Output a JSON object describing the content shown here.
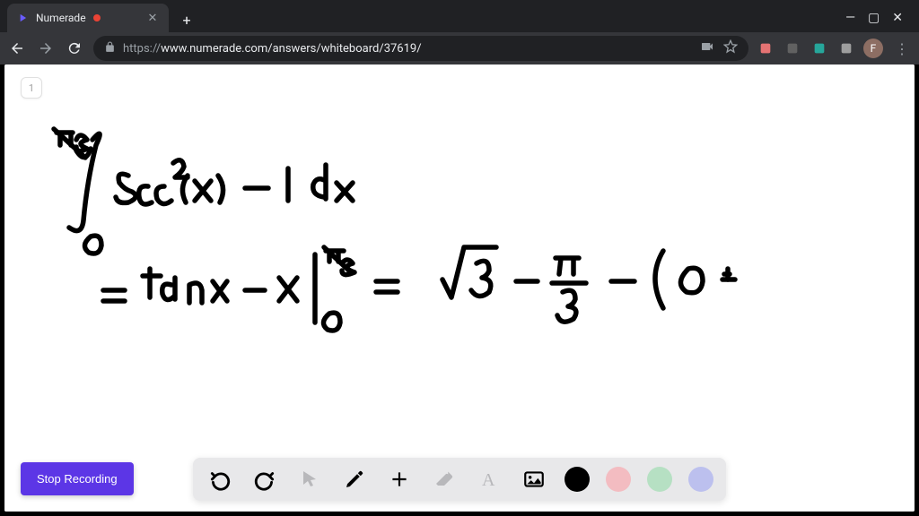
{
  "browser": {
    "tab_title": "Numerade",
    "url_scheme": "https://",
    "url_rest": "www.numerade.com/answers/whiteboard/37619/",
    "avatar_initial": "F"
  },
  "page": {
    "page_number": "1",
    "stop_recording_label": "Stop Recording"
  },
  "handwriting": {
    "line1": "∫₀^{π/3} sec²(x) − 1  dx",
    "line2": "= tan x − x |₀^{π/3}  =  √3 − π/3 − ( 0 −"
  },
  "toolbar": {
    "tools": [
      "undo",
      "redo",
      "cursor",
      "pen",
      "add",
      "eraser",
      "text",
      "image"
    ],
    "colors": [
      "#000000",
      "#f3bcc1",
      "#b6e0c3",
      "#bcc0ee"
    ]
  }
}
